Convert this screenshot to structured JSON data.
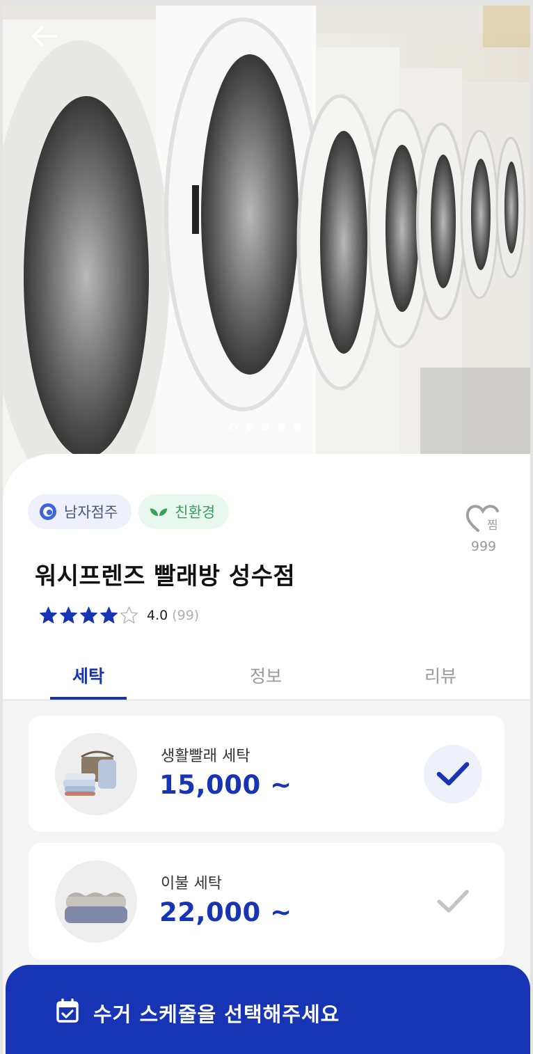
{
  "hero": {
    "back_icon": "arrow-left-icon",
    "carousel": {
      "count": 5,
      "active_index": 0
    }
  },
  "store": {
    "tags": [
      {
        "label": "남자점주",
        "icon": "person-circle-icon",
        "color": "#4a5878"
      },
      {
        "label": "친환경",
        "icon": "leaf-icon",
        "color": "#3a9e5d"
      }
    ],
    "favorite": {
      "icon": "heart-jjim-icon",
      "icon_text": "찜",
      "count": "999"
    },
    "name": "워시프렌즈 빨래방 성수점",
    "rating": {
      "stars": 4,
      "max": 5,
      "value": "4.0",
      "count": "(99)"
    }
  },
  "tabs": [
    {
      "label": "세탁",
      "active": true
    },
    {
      "label": "정보",
      "active": false
    },
    {
      "label": "리뷰",
      "active": false
    }
  ],
  "services": [
    {
      "name": "생활빨래 세탁",
      "price": "15,000 ~",
      "selected": true
    },
    {
      "name": "이불 세탁",
      "price": "22,000 ~",
      "selected": false
    }
  ],
  "cta": {
    "icon": "calendar-check-icon",
    "label": "수거 스케줄을 선택해주세요"
  },
  "colors": {
    "primary": "#1634b4",
    "green": "#3a9e5d",
    "star": "#1634b4"
  }
}
